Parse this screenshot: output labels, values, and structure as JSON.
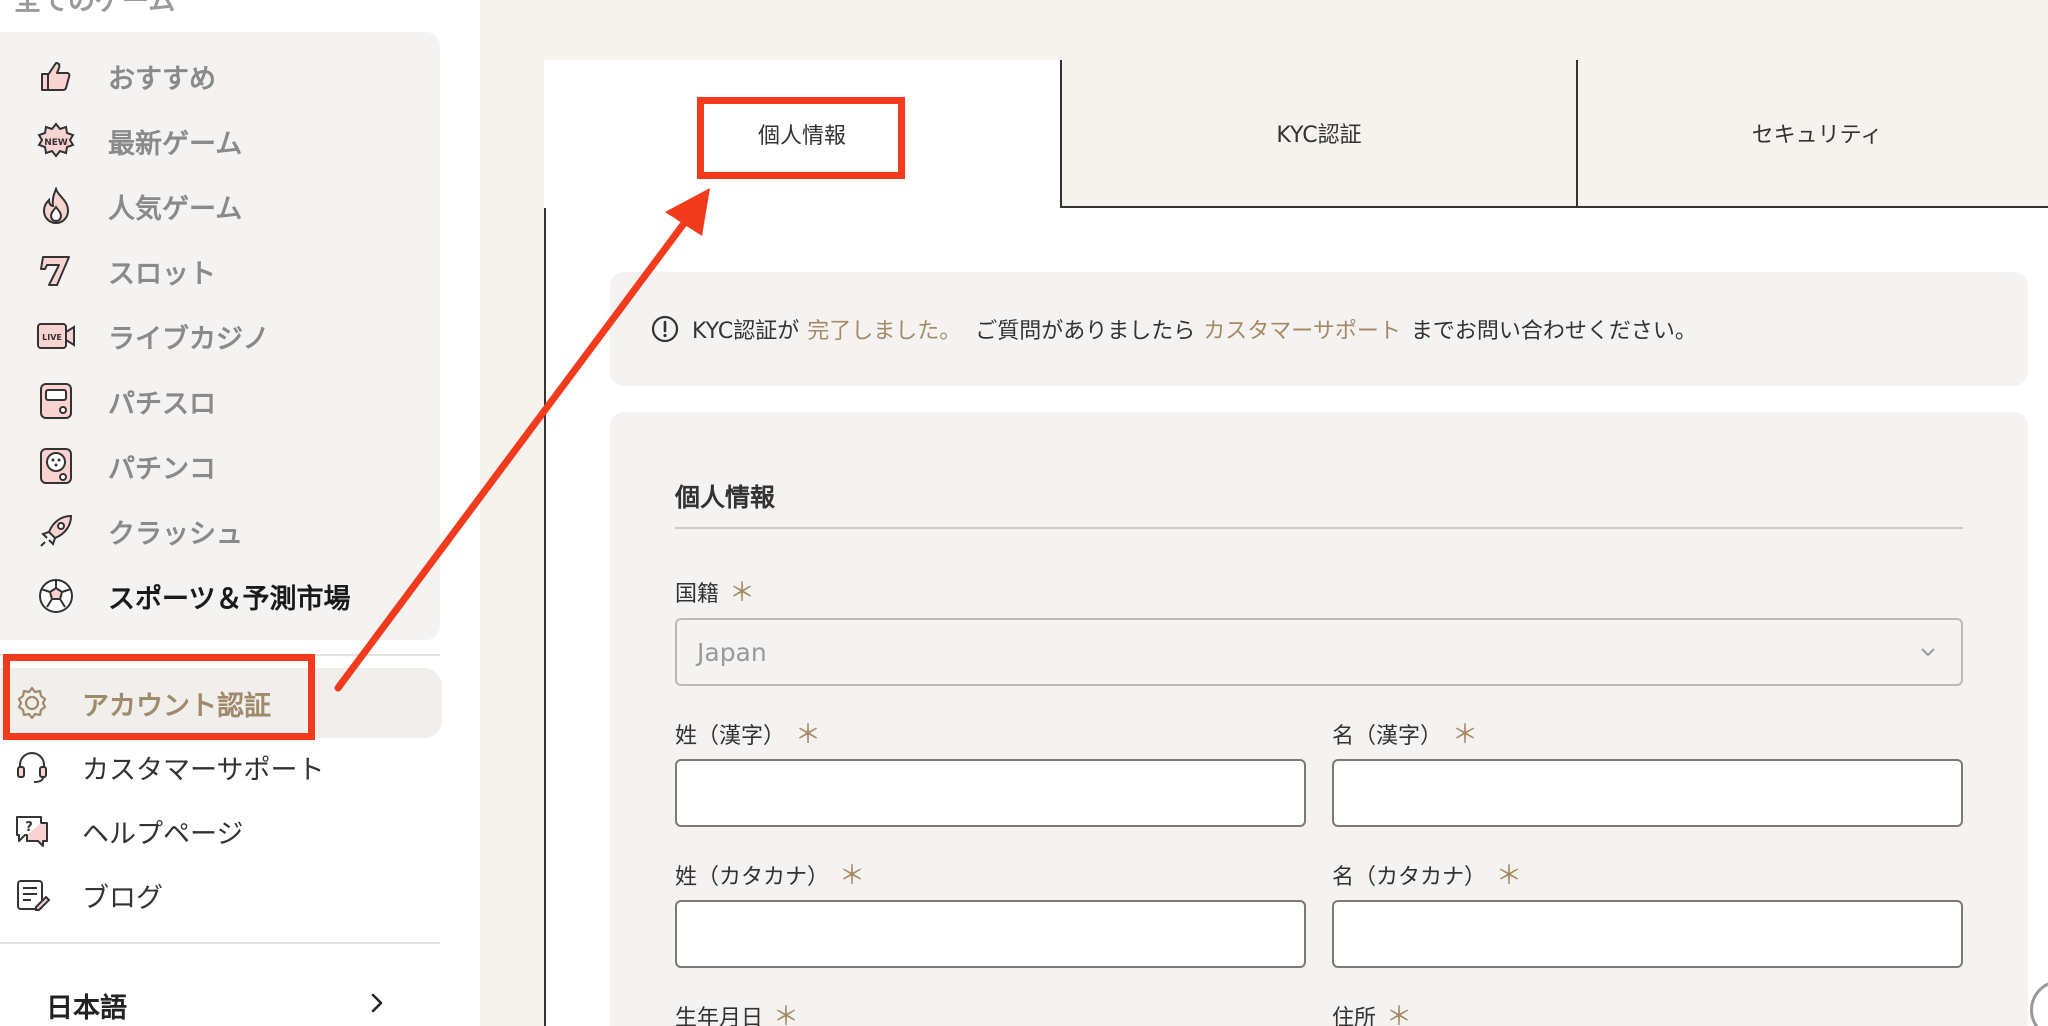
{
  "sidebar": {
    "all_games": "全てのゲーム",
    "games": [
      {
        "label": "おすすめ",
        "icon": "thumbs-up-icon"
      },
      {
        "label": "最新ゲーム",
        "icon": "new-badge-icon"
      },
      {
        "label": "人気ゲーム",
        "icon": "flame-icon"
      },
      {
        "label": "スロット",
        "icon": "lucky-seven-icon"
      },
      {
        "label": "ライブカジノ",
        "icon": "live-camera-icon"
      },
      {
        "label": "パチスロ",
        "icon": "pachislot-icon"
      },
      {
        "label": "パチンコ",
        "icon": "pachinko-icon"
      },
      {
        "label": "クラッシュ",
        "icon": "rocket-icon"
      },
      {
        "label": "スポーツ＆予測市場",
        "icon": "soccer-ball-icon"
      }
    ],
    "account": {
      "label": "アカウント認証",
      "icon": "gear-icon"
    },
    "support": [
      {
        "label": "カスタマーサポート",
        "icon": "headset-icon"
      },
      {
        "label": "ヘルプページ",
        "icon": "help-chat-icon"
      },
      {
        "label": "ブログ",
        "icon": "blog-document-icon"
      }
    ],
    "language": "日本語"
  },
  "tabs": [
    {
      "label": "個人情報",
      "active": true
    },
    {
      "label": "KYC認証",
      "active": false
    },
    {
      "label": "セキュリティ",
      "active": false
    }
  ],
  "notice": {
    "prefix": "KYC認証が",
    "status": "完了しました。",
    "middle": "ご質問がありましたら",
    "link": "カスタマーサポート",
    "suffix": "までお問い合わせください。"
  },
  "form": {
    "title": "個人情報",
    "nationality_label": "国籍",
    "nationality_value": "Japan",
    "last_name_kanji": "姓（漢字）",
    "first_name_kanji": "名（漢字）",
    "last_name_kana": "姓（カタカナ）",
    "first_name_kana": "名（カタカナ）",
    "birthdate": "生年月日",
    "address": "住所",
    "required_mark": "＊"
  },
  "colors": {
    "accent": "#a58a63",
    "annotation": "#f23a1c"
  }
}
